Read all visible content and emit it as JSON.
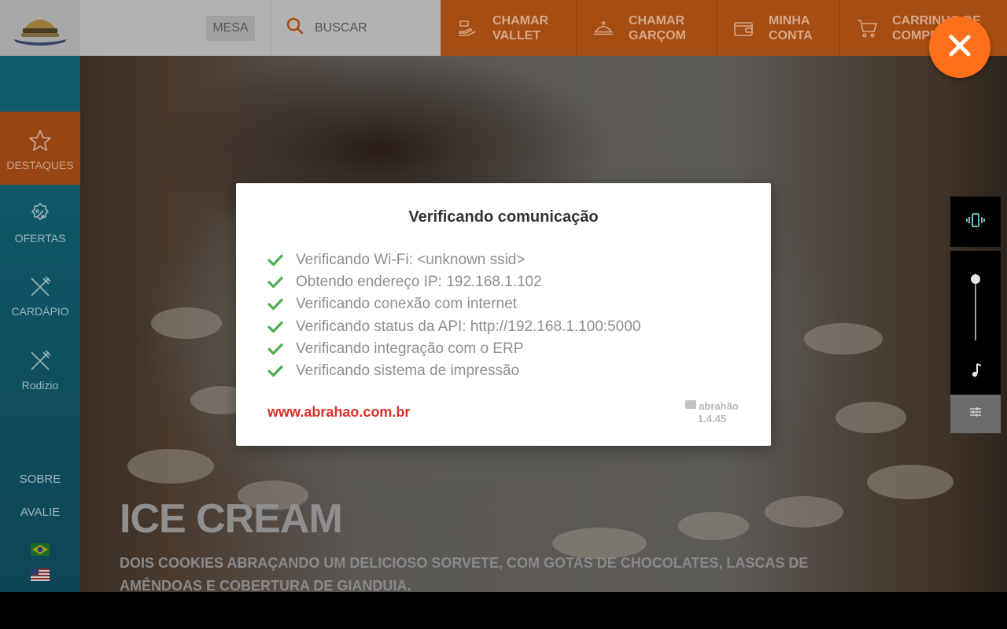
{
  "header": {
    "mesa_label": "MESA",
    "search_label": "BUSCAR",
    "actions": [
      {
        "line1": "CHAMAR",
        "line2": "VALLET",
        "icon": "valet-hand-icon"
      },
      {
        "line1": "CHAMAR",
        "line2": "GARÇOM",
        "icon": "waiter-cloche-icon"
      },
      {
        "line1": "MINHA",
        "line2": "CONTA",
        "icon": "wallet-icon"
      },
      {
        "line1": "CARRINHO DE",
        "line2": "COMPRAS",
        "icon": "cart-icon"
      }
    ]
  },
  "sidebar": {
    "items": [
      {
        "label": "DESTAQUES",
        "icon": "star-icon"
      },
      {
        "label": "OFERTAS",
        "icon": "discount-badge-icon"
      },
      {
        "label": "CARDÁPIO",
        "icon": "fork-knife-icon"
      },
      {
        "label": "Rodizio",
        "icon": "fork-knife-icon"
      }
    ],
    "links": {
      "about": "SOBRE",
      "rate": "AVALIE"
    },
    "languages": [
      "brazil-flag-icon",
      "usa-flag-icon"
    ]
  },
  "hero": {
    "title": "ICE CREAM",
    "description": "DOIS COOKIES ABRAÇANDO UM DELICIOSO SORVETE, COM GOTAS DE CHOCOLATES, LASCAS DE AMÊNDOAS E COBERTURA DE GIANDUIA."
  },
  "dialog": {
    "title": "Verificando comunicação",
    "checks": [
      "Verificando Wi-Fi: <unknown ssid>",
      "Obtendo endereço IP: 192.168.1.102",
      "Verificando conexão com internet",
      "Verificando status da API: http://192.168.1.100:5000",
      "Verificando integração com o ERP",
      "Verificando sistema de impressão"
    ],
    "website": "www.abrahao.com.br",
    "brand": "abrahão",
    "version": "1.4.45"
  },
  "colors": {
    "orange_accent": "#fe6f1a",
    "check_green": "#4caf50",
    "link_red": "#d8302a"
  },
  "volume": {
    "level": 0.92
  }
}
